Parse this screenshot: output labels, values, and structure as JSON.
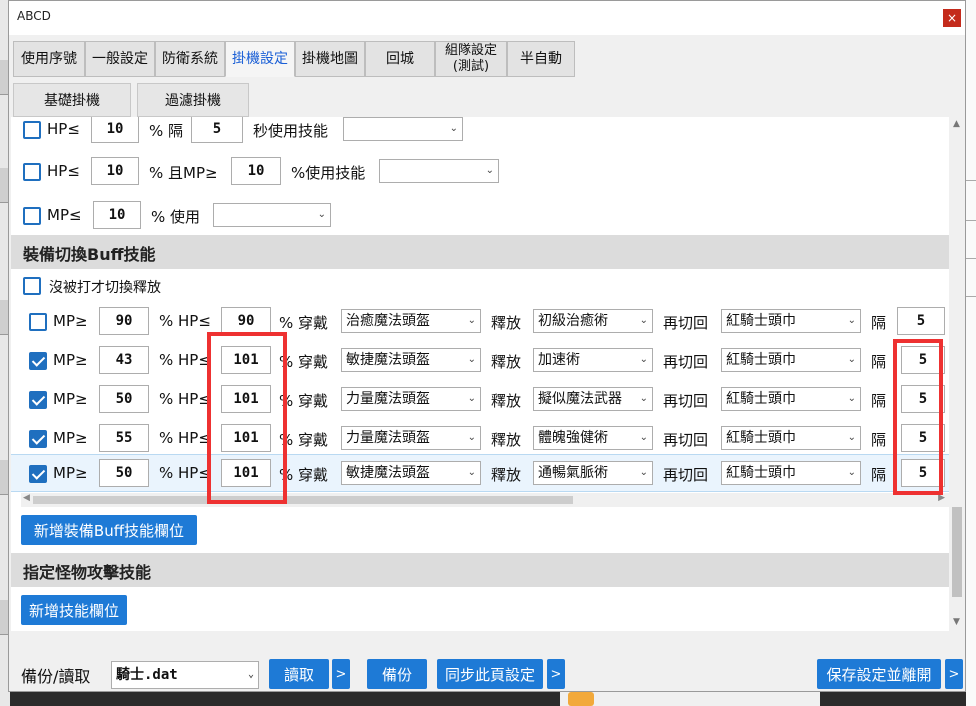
{
  "window": {
    "title": "ABCD",
    "close_glyph": "×"
  },
  "tabs": [
    {
      "label": "使用序號",
      "active": false
    },
    {
      "label": "一般設定",
      "active": false
    },
    {
      "label": "防衛系統",
      "active": false
    },
    {
      "label": "掛機設定",
      "active": true
    },
    {
      "label": "掛機地圖",
      "active": false
    },
    {
      "label": "回城",
      "active": false
    },
    {
      "label": "組隊設定",
      "label2": "(測試)",
      "active": false
    },
    {
      "label": "半自動",
      "active": false
    }
  ],
  "subtabs": [
    {
      "label": "基礎掛機"
    },
    {
      "label": "過濾掛機"
    }
  ],
  "hp_skill_rows": [
    {
      "checked": false,
      "hp_label": "HP≤",
      "hp_value": "10",
      "mid_label": "% 隔",
      "interval": "5",
      "suffix": "秒使用技能",
      "skill": ""
    },
    {
      "checked": false,
      "hp_label": "HP≤",
      "hp_value": "10",
      "mid_label": "% 且MP≥",
      "mp_value": "10",
      "suffix": "%使用技能",
      "skill": ""
    },
    {
      "checked": false,
      "mp_label": "MP≤",
      "mp_value": "10",
      "suffix": "% 使用",
      "skill": ""
    }
  ],
  "buff_section": {
    "title": "裝備切換Buff技能",
    "no_hit_checkbox": {
      "checked": false,
      "label": "沒被打才切換釋放"
    },
    "labels": {
      "mp": "MP≥",
      "hp": "% HP≤",
      "wear": "% 穿戴",
      "release": "釋放",
      "switch_back": "再切回",
      "interval": "隔"
    },
    "rows": [
      {
        "checked": false,
        "mp": "90",
        "hp": "90",
        "equip": "治癒魔法頭盔",
        "skill": "初級治癒術",
        "back": "紅騎士頭巾",
        "interval": "5"
      },
      {
        "checked": true,
        "mp": "43",
        "hp": "101",
        "equip": "敏捷魔法頭盔",
        "skill": "加速術",
        "back": "紅騎士頭巾",
        "interval": "5"
      },
      {
        "checked": true,
        "mp": "50",
        "hp": "101",
        "equip": "力量魔法頭盔",
        "skill": "擬似魔法武器",
        "back": "紅騎士頭巾",
        "interval": "5"
      },
      {
        "checked": true,
        "mp": "55",
        "hp": "101",
        "equip": "力量魔法頭盔",
        "skill": "體魄強健術",
        "back": "紅騎士頭巾",
        "interval": "5"
      },
      {
        "checked": true,
        "mp": "50",
        "hp": "101",
        "equip": "敏捷魔法頭盔",
        "skill": "通暢氣脈術",
        "back": "紅騎士頭巾",
        "interval": "5"
      }
    ],
    "add_button": "新增裝備Buff技能欄位"
  },
  "monster_section": {
    "title": "指定怪物攻擊技能",
    "add_button": "新增技能欄位"
  },
  "bottom": {
    "backup_label": "備份/讀取",
    "file": "騎士.dat",
    "read_btn": "讀取",
    "more_glyph": ">",
    "backup_btn": "備份",
    "sync_btn": "同步此頁設定",
    "save_btn": "保存設定並離開"
  },
  "colors": {
    "accent": "#1e7ad6",
    "highlight_box": "#ee3131",
    "active_tab_text": "#1a5fd6"
  }
}
